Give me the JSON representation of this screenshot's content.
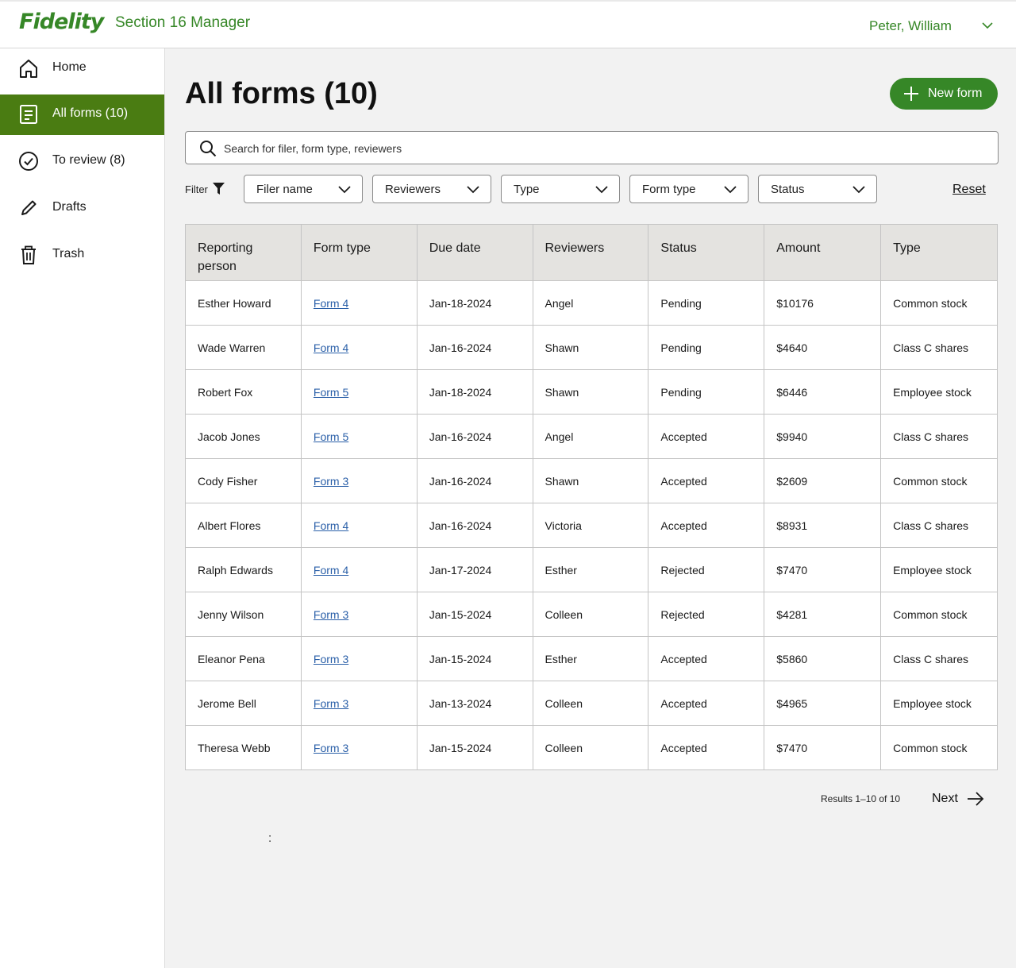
{
  "header": {
    "logo_text": "Fidelity",
    "app_name": "Section 16 Manager",
    "user_name": "Peter, William",
    "brand_color": "#368727"
  },
  "sidebar": {
    "items": [
      {
        "label": "Home",
        "icon": "home-icon",
        "active": false
      },
      {
        "label": "All forms (10)",
        "icon": "document-icon",
        "active": true
      },
      {
        "label": "To review (8)",
        "icon": "check-circle-icon",
        "active": false
      },
      {
        "label": "Drafts",
        "icon": "pencil-icon",
        "active": false
      },
      {
        "label": "Trash",
        "icon": "trash-icon",
        "active": false
      }
    ],
    "active_color": "#4a7c12"
  },
  "main": {
    "title": "All forms (10)",
    "new_form_label": "New form",
    "search_placeholder": "Search for filer, form type, reviewers",
    "filter_label": "Filter",
    "filters": [
      "Filer name",
      "Reviewers",
      "Type",
      "Form type",
      "Status"
    ],
    "reset_label": "Reset",
    "table": {
      "columns": [
        "Reporting person",
        "Form type",
        "Due date",
        "Reviewers",
        "Status",
        "Amount",
        "Type"
      ],
      "rows": [
        [
          "Esther Howard",
          "Form 4",
          "Jan-18-2024",
          "Angel",
          "Pending",
          "$10176",
          "Common stock"
        ],
        [
          "Wade Warren",
          "Form 4",
          "Jan-16-2024",
          "Shawn",
          "Pending",
          "$4640",
          "Class C shares"
        ],
        [
          "Robert Fox",
          "Form 5",
          "Jan-18-2024",
          "Shawn",
          "Pending",
          "$6446",
          "Employee stock"
        ],
        [
          "Jacob Jones",
          "Form 5",
          "Jan-16-2024",
          "Angel",
          "Accepted",
          "$9940",
          "Class C shares"
        ],
        [
          "Cody Fisher",
          "Form 3",
          "Jan-16-2024",
          "Shawn",
          "Accepted",
          "$2609",
          "Common stock"
        ],
        [
          "Albert Flores",
          "Form 4",
          "Jan-16-2024",
          "Victoria",
          "Accepted",
          "$8931",
          "Class C shares"
        ],
        [
          "Ralph Edwards",
          "Form 4",
          "Jan-17-2024",
          "Esther",
          "Rejected",
          "$7470",
          "Employee stock"
        ],
        [
          "Jenny Wilson",
          "Form 3",
          "Jan-15-2024",
          "Colleen",
          "Rejected",
          "$4281",
          "Common stock"
        ],
        [
          "Eleanor Pena",
          "Form 3",
          "Jan-15-2024",
          "Esther",
          "Accepted",
          "$5860",
          "Class C shares"
        ],
        [
          "Jerome Bell",
          "Form 3",
          "Jan-13-2024",
          "Colleen",
          "Accepted",
          "$4965",
          "Employee stock"
        ],
        [
          "Theresa Webb",
          "Form 3",
          "Jan-15-2024",
          "Colleen",
          "Accepted",
          "$7470",
          "Common stock"
        ]
      ]
    },
    "pagination": {
      "results_text": "Results 1–10 of 10",
      "next_label": "Next"
    },
    "stray_text": ":"
  }
}
